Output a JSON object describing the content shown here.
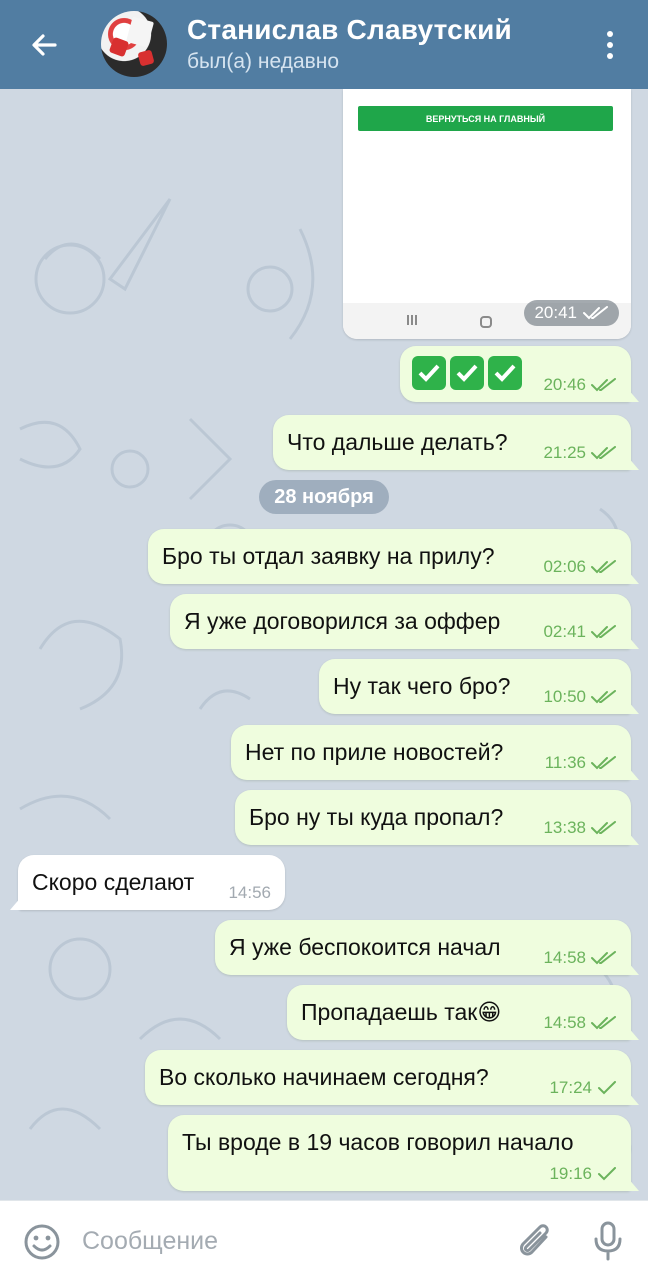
{
  "header": {
    "title": "Станислав Славутский",
    "status": "был(а) недавно",
    "back_icon": "arrow-left-icon",
    "menu_icon": "more-vertical-icon"
  },
  "colors": {
    "header_bg": "#517da2",
    "chat_bg": "#cfd8e2",
    "out_bubble": "#effdde",
    "in_bubble": "#ffffff",
    "read_check": "#6bb35c"
  },
  "screenshot_message": {
    "button_label": "ВЕРНУТЬСЯ НА ГЛАВНЫЙ",
    "time": "20:41"
  },
  "date_separator": "28 ноября",
  "messages": [
    {
      "direction": "out",
      "text": "",
      "emoji": "✅✅✅",
      "time": "20:46",
      "status": "read"
    },
    {
      "direction": "out",
      "text": "Что дальше делать?",
      "time": "21:25",
      "status": "read"
    },
    {
      "direction": "out",
      "text": "Бро ты отдал заявку на прилу?",
      "time": "02:06",
      "status": "read"
    },
    {
      "direction": "out",
      "text": "Я уже договорился за оффер",
      "time": "02:41",
      "status": "read"
    },
    {
      "direction": "out",
      "text": "Ну так чего бро?",
      "time": "10:50",
      "status": "read"
    },
    {
      "direction": "out",
      "text": "Нет по приле новостей?",
      "time": "11:36",
      "status": "read"
    },
    {
      "direction": "out",
      "text": "Бро ну ты куда пропал?",
      "time": "13:38",
      "status": "read"
    },
    {
      "direction": "in",
      "text": "Скоро сделают",
      "time": "14:56"
    },
    {
      "direction": "out",
      "text": "Я уже беспокоится начал",
      "time": "14:58",
      "status": "read"
    },
    {
      "direction": "out",
      "text": "Пропадаешь так😁",
      "time": "14:58",
      "status": "read"
    },
    {
      "direction": "out",
      "text": "Во сколько начинаем сегодня?",
      "time": "17:24",
      "status": "sent"
    },
    {
      "direction": "out",
      "text": "Ты вроде в 19 часов говорил начало",
      "time": "19:16",
      "status": "sent"
    }
  ],
  "input": {
    "placeholder": "Сообщение",
    "emoji_icon": "smile-icon",
    "attach_icon": "paperclip-icon",
    "mic_icon": "microphone-icon"
  }
}
